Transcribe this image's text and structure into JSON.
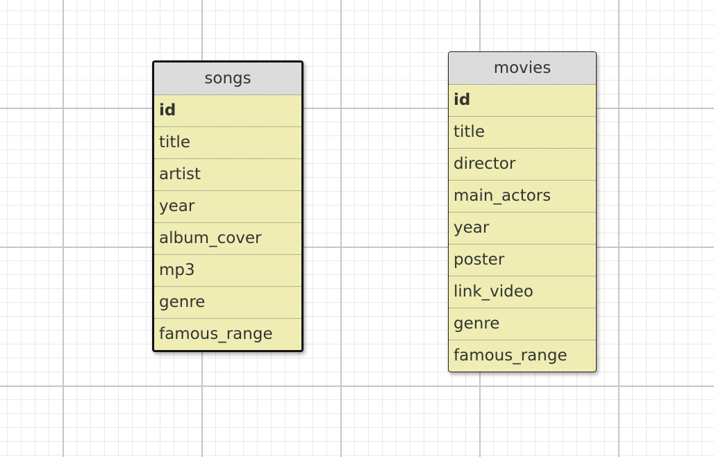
{
  "tables": [
    {
      "name": "songs",
      "fields": [
        {
          "name": "id",
          "primary": true
        },
        {
          "name": "title"
        },
        {
          "name": "artist"
        },
        {
          "name": "year"
        },
        {
          "name": "album_cover"
        },
        {
          "name": "mp3"
        },
        {
          "name": "genre"
        },
        {
          "name": "famous_range"
        }
      ]
    },
    {
      "name": "movies",
      "fields": [
        {
          "name": "id",
          "primary": true
        },
        {
          "name": "title"
        },
        {
          "name": "director"
        },
        {
          "name": "main_actors"
        },
        {
          "name": "year"
        },
        {
          "name": "poster"
        },
        {
          "name": "link_video"
        },
        {
          "name": "genre"
        },
        {
          "name": "famous_range"
        }
      ]
    }
  ],
  "colors": {
    "header_bg": "#dcdcdc",
    "field_bg": "#efedb3",
    "text": "#333333"
  }
}
